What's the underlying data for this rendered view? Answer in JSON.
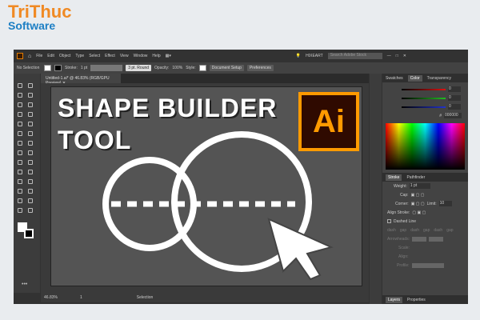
{
  "brand": {
    "line1": "TriThuc",
    "line2": "Software"
  },
  "menu": [
    "File",
    "Edit",
    "Object",
    "Type",
    "Select",
    "Effect",
    "View",
    "Window",
    "Help"
  ],
  "workspace": "HIXEART",
  "search_placeholder": "Search Adobe Stock",
  "control": {
    "selection": "No Selection",
    "stroke_label": "Stroke:",
    "stroke_value": "1 pt",
    "brush": "3 pt. Round",
    "opacity_label": "Opacity:",
    "opacity_value": "100%",
    "style_label": "Style:",
    "doc_setup": "Document Setup",
    "preferences": "Preferences"
  },
  "document_tab": "Untitled-1.ai* @ 46.83% (RGB/GPU Preview)",
  "artboard": {
    "line1": "SHAPE BUILDER",
    "line2": "TOOL",
    "logo": "Ai"
  },
  "status": {
    "zoom": "46.83%",
    "page": "1",
    "tool": "Selection"
  },
  "color_panel": {
    "tabs": [
      "Swatches",
      "Color",
      "Transparency"
    ],
    "values": [
      "0",
      "0",
      "0"
    ],
    "hex": "000000",
    "colors": {
      "r": "#d11",
      "g": "#2b2",
      "b": "#23c"
    }
  },
  "stroke_panel": {
    "tabs": [
      "Stroke",
      "Pathfinder"
    ],
    "weight_label": "Weight:",
    "weight": "1 pt",
    "cap_label": "Cap:",
    "corner_label": "Corner:",
    "limit_label": "Limit:",
    "limit": "10",
    "align_label": "Align Stroke:",
    "dashed_label": "Dashed Line",
    "dash_fields": [
      "dash",
      "gap",
      "dash",
      "gap",
      "dash",
      "gap"
    ],
    "arrowheads": "Arrowheads:",
    "scale": "Scale:",
    "align": "Align:",
    "profile": "Profile:"
  },
  "bottom_tabs": [
    "Layers",
    "Properties"
  ]
}
